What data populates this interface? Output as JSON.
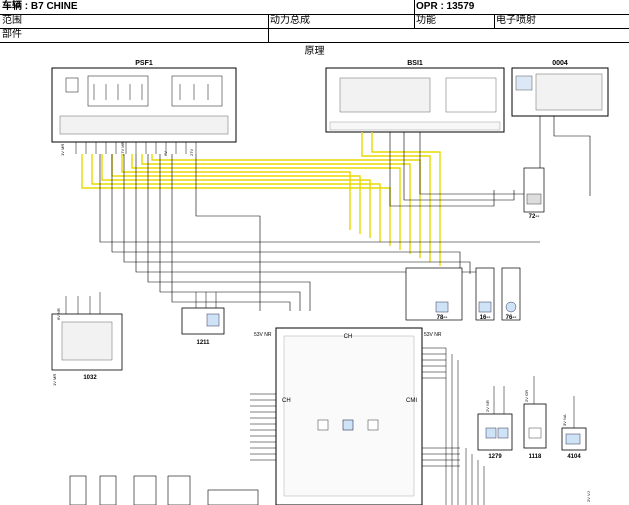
{
  "header": {
    "vehicle": "车辆 : B7 CHINE",
    "opr": "OPR : 13579",
    "scope_label": "范围",
    "assembly": "动力总成",
    "function_label": "功能",
    "function_value": "电子喷射",
    "part_label": "部件"
  },
  "title": "原理",
  "components": {
    "psf1": "PSF1",
    "bsi1": "BSI1",
    "c0004": "0004",
    "c1032": "1032",
    "c1211": "1211",
    "c1279": "1279",
    "c1118": "1118",
    "c4104": "4104",
    "c78": "78--",
    "c16": "16--",
    "c76": "76--",
    "c72": "72--",
    "ch_top": "CH",
    "ch_left": "CH",
    "cmi": "CMI",
    "vr53_left": "53V NR",
    "vr53_right": "53V NR",
    "c_2vnr": "2V NR",
    "c_2vgr": "2V GR",
    "c_3vna": "3V NA",
    "c_6vnr": "6V NR",
    "c_1vmr": "1V MR",
    "c_2vvj": "2V VJ"
  }
}
